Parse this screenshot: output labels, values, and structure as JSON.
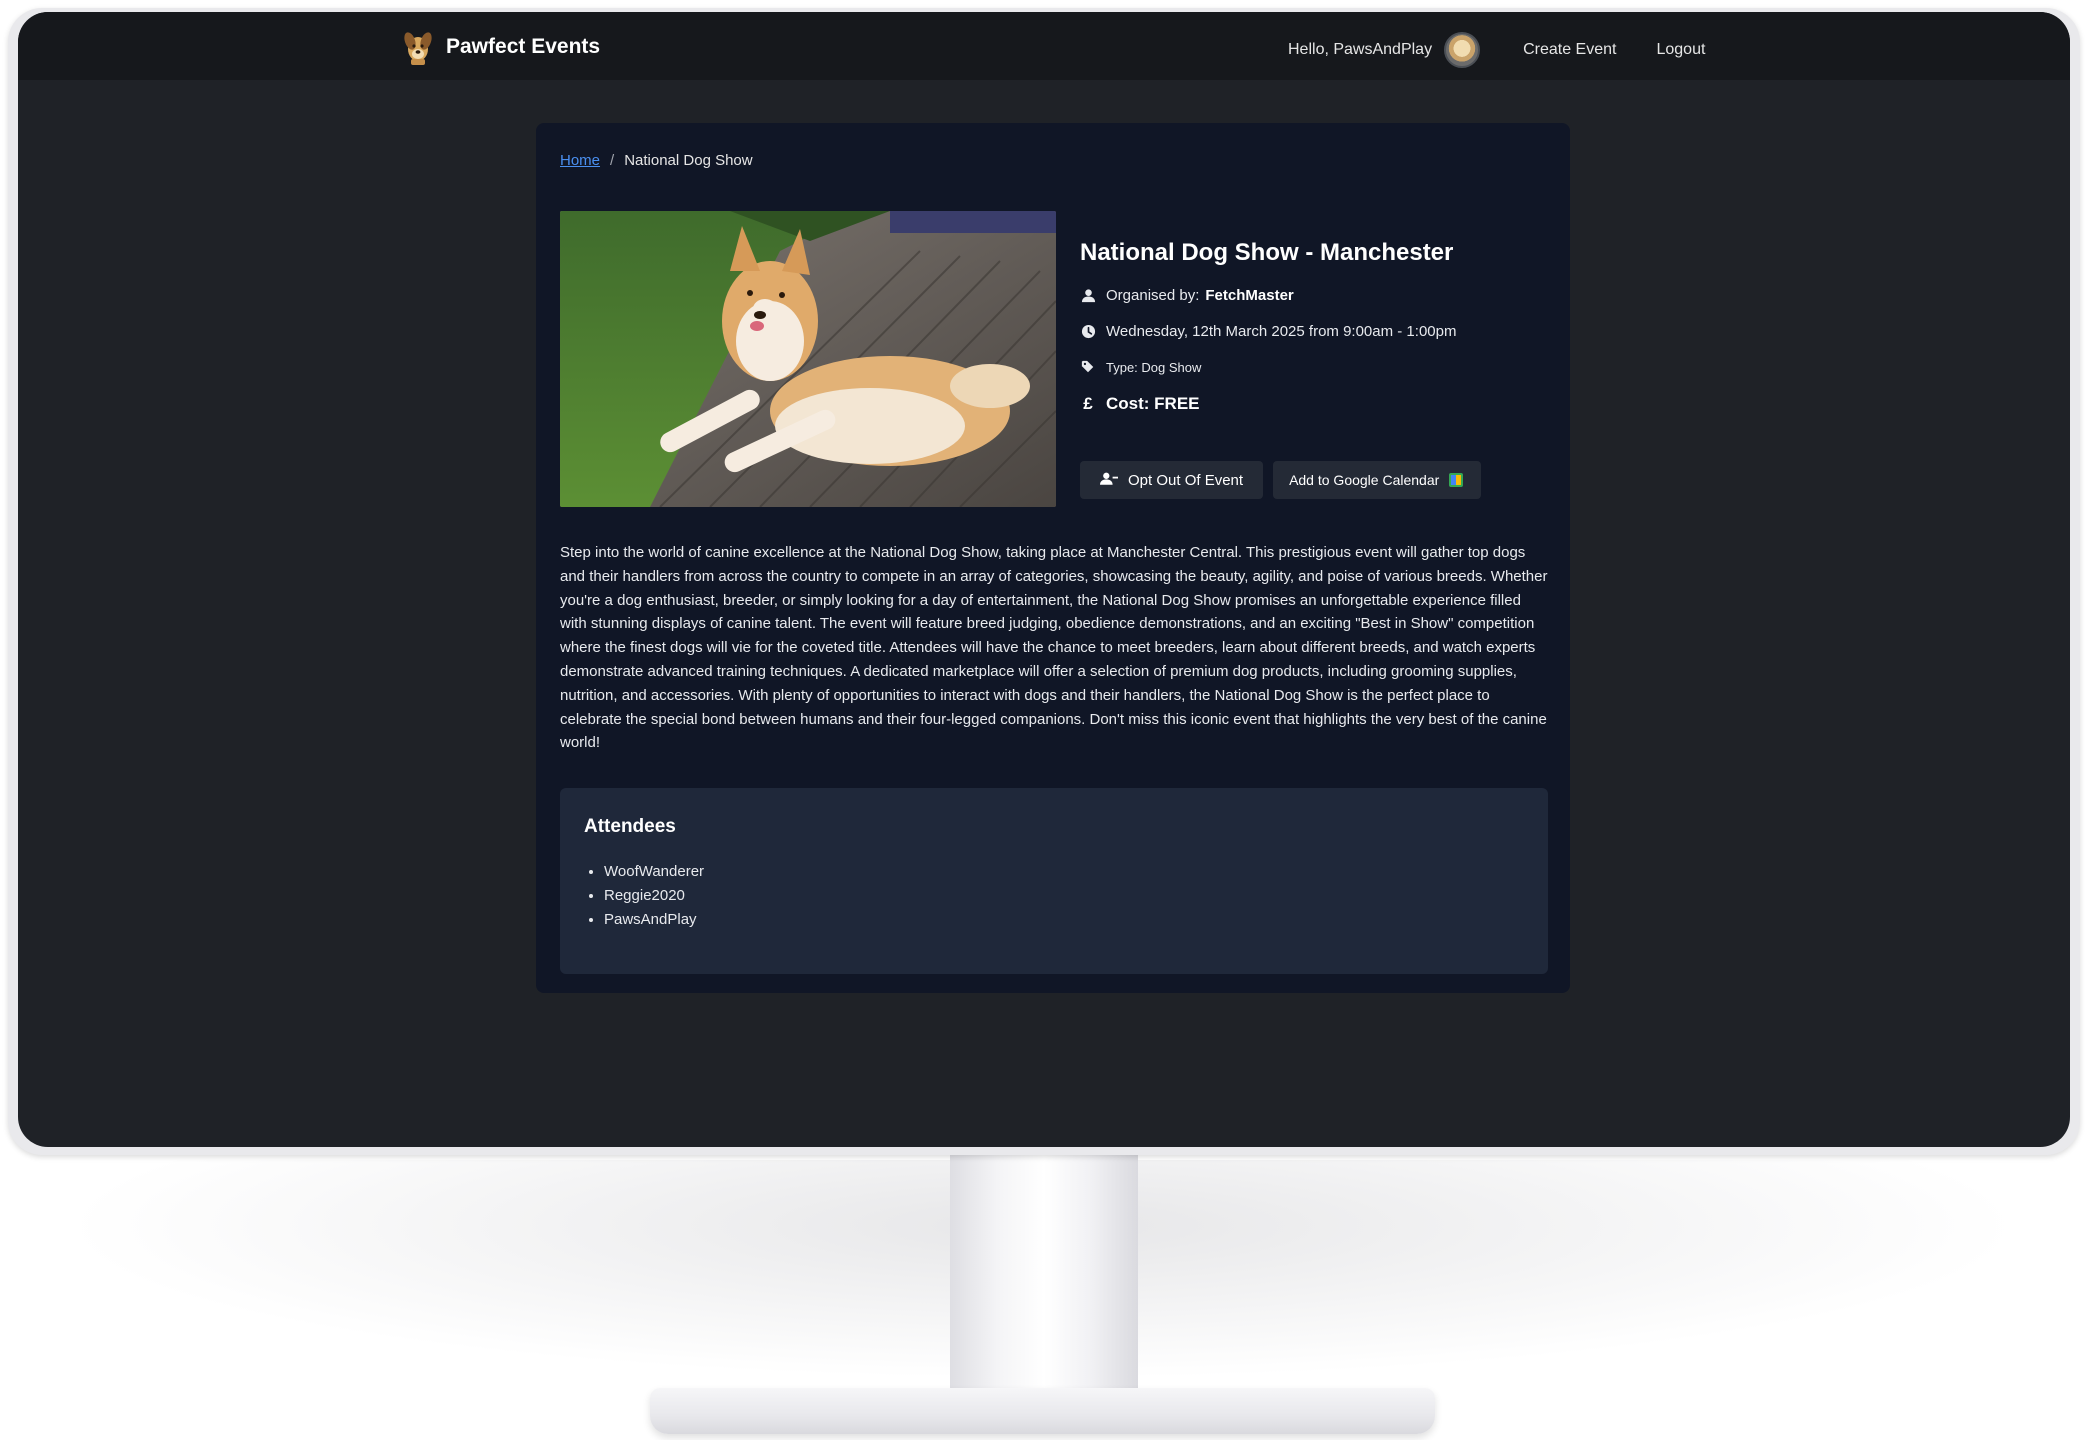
{
  "navbar": {
    "brand": "Pawfect Events",
    "greeting": "Hello, PawsAndPlay",
    "links": [
      "Create Event",
      "Logout"
    ]
  },
  "breadcrumb": {
    "home": "Home",
    "separator": "/",
    "current": "National Dog Show"
  },
  "event": {
    "title": "National Dog Show - Manchester",
    "organiser_label": "Organised by:",
    "organiser": "FetchMaster",
    "datetime": "Wednesday, 12th March 2025 from 9:00am - 1:00pm",
    "type": "Type: Dog Show",
    "cost": "Cost: FREE",
    "currency_symbol": "£",
    "opt_out_label": "Opt Out Of Event",
    "calendar_label": "Add to Google Calendar",
    "description": "Step into the world of canine excellence at the National Dog Show, taking place at Manchester Central. This prestigious event will gather top dogs and their handlers from across the country to compete in an array of categories, showcasing the beauty, agility, and poise of various breeds. Whether you're a dog enthusiast, breeder, or simply looking for a day of entertainment, the National Dog Show promises an unforgettable experience filled with stunning displays of canine talent. The event will feature breed judging, obedience demonstrations, and an exciting \"Best in Show\" competition where the finest dogs will vie for the coveted title. Attendees will have the chance to meet breeders, learn about different breeds, and watch experts demonstrate advanced training techniques. A dedicated marketplace will offer a selection of premium dog products, including grooming supplies, nutrition, and accessories. With plenty of opportunities to interact with dogs and their handlers, the National Dog Show is the perfect place to celebrate the special bond between humans and their four-legged companions. Don't miss this iconic event that highlights the very best of the canine world!"
  },
  "attendees": {
    "heading": "Attendees",
    "list": [
      "WoofWanderer",
      "Reggie2020",
      "PawsAndPlay"
    ]
  },
  "icons": {
    "organiser": "user-icon",
    "datetime": "clock-icon",
    "type": "tag-icon",
    "cost": "pound-icon",
    "opt_out": "user-minus-icon",
    "calendar": "google-calendar-icon"
  }
}
